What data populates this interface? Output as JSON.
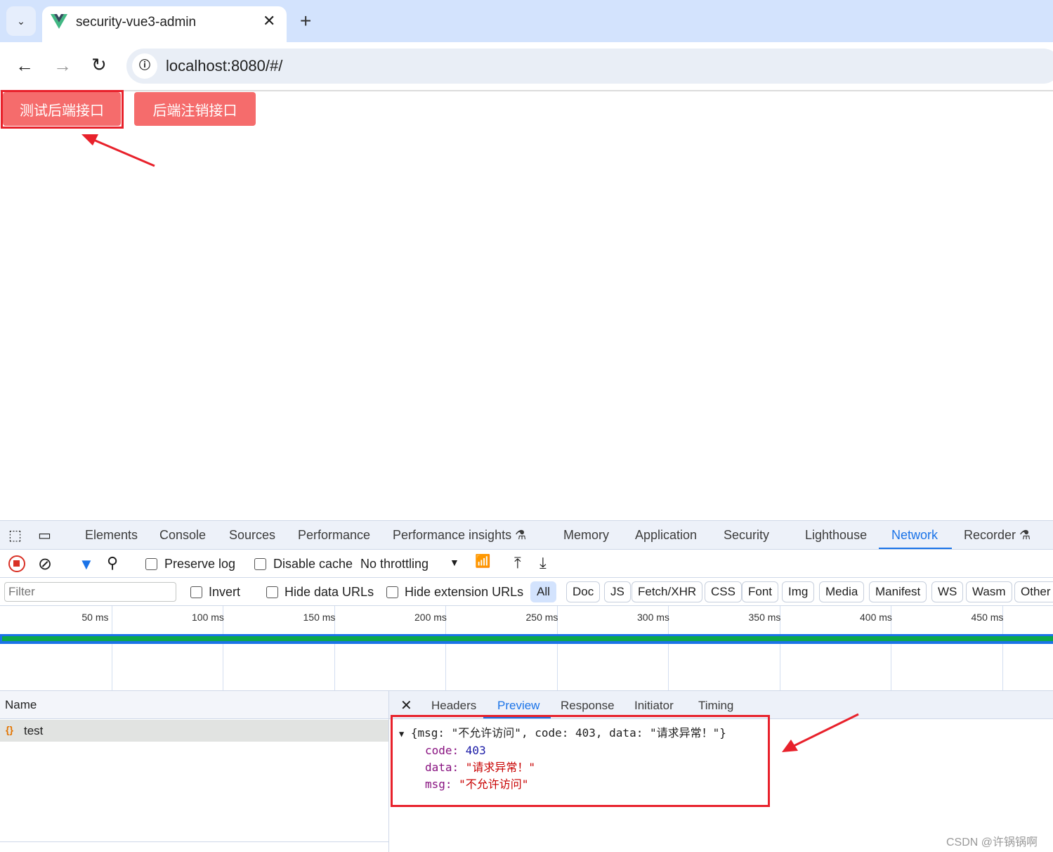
{
  "browser": {
    "tab_title": "security-vue3-admin",
    "url": "localhost:8080/#/"
  },
  "page": {
    "buttons": [
      "测试后端接口",
      "后端注销接口"
    ]
  },
  "devtools": {
    "tabs": [
      "Elements",
      "Console",
      "Sources",
      "Performance",
      "Performance insights",
      "Memory",
      "Application",
      "Security",
      "Lighthouse",
      "Network",
      "Recorder"
    ],
    "active_tab": "Network",
    "toolbar": {
      "preserve_log": "Preserve log",
      "disable_cache": "Disable cache",
      "throttling": "No throttling"
    },
    "filter": {
      "placeholder": "Filter",
      "invert": "Invert",
      "hide_data": "Hide data URLs",
      "hide_ext": "Hide extension URLs",
      "types": [
        "All",
        "Doc",
        "JS",
        "Fetch/XHR",
        "CSS",
        "Font",
        "Img",
        "Media",
        "Manifest",
        "WS",
        "Wasm",
        "Other"
      ],
      "active_type": "All"
    },
    "timeline_ticks": [
      "50 ms",
      "100 ms",
      "150 ms",
      "200 ms",
      "250 ms",
      "300 ms",
      "350 ms",
      "400 ms",
      "450 ms"
    ],
    "requests": {
      "header": "Name",
      "items": [
        {
          "name": "test"
        }
      ]
    },
    "detail_tabs": [
      "Headers",
      "Preview",
      "Response",
      "Initiator",
      "Timing"
    ],
    "active_detail": "Preview",
    "preview": {
      "summary": "{msg: \"不允许访问\", code: 403, data: \"请求异常！\"}",
      "code_key": "code: ",
      "code_val": "403",
      "data_key": "data: ",
      "data_val": "\"请求异常！\"",
      "msg_key": "msg: ",
      "msg_val": "\"不允许访问\""
    }
  },
  "watermark": "CSDN @许锅锅啊",
  "colors": {
    "button": "#f56c6c",
    "accent": "#1a73e8",
    "annotation": "#e8212b"
  }
}
